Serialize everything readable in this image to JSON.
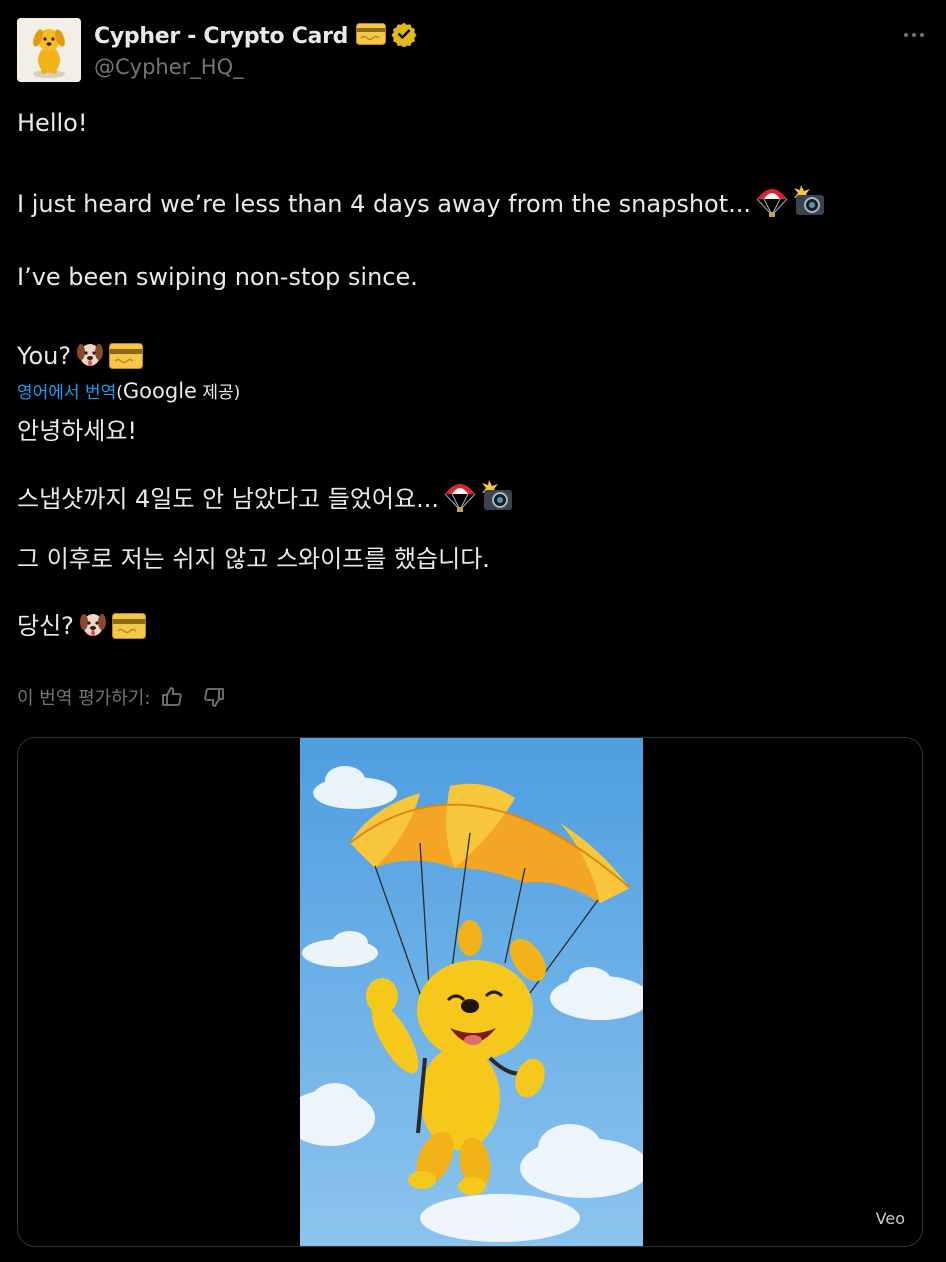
{
  "author": {
    "display_name": "Cypher - Crypto Card",
    "handle": "@Cypher_HQ_",
    "avatar_icon": "yellow-dog-avatar",
    "verified_color": "#e2b719"
  },
  "tweet": {
    "lines": [
      "Hello!",
      "I just heard we’re less than 4 days away from the snapshot...",
      "I’ve been swiping non-stop since.",
      "You?"
    ]
  },
  "translation": {
    "link_label": "영어에서 번역",
    "open_paren": "(",
    "google": "Google",
    "provided": " 제공)",
    "lines": [
      "안녕하세요!",
      "스냅샷까지 4일도 안 남았다고 들었어요...",
      "그 이후로 저는 쉬지 않고 스와이프를 했습니다.",
      "당신?"
    ],
    "rate_label": "이 번역 평가하기:"
  },
  "media": {
    "badge": "Veo",
    "sky_color": "#6fb0e6"
  },
  "colors": {
    "link": "#1d9bf0",
    "muted": "#71767b",
    "text": "#e7e9ea"
  }
}
